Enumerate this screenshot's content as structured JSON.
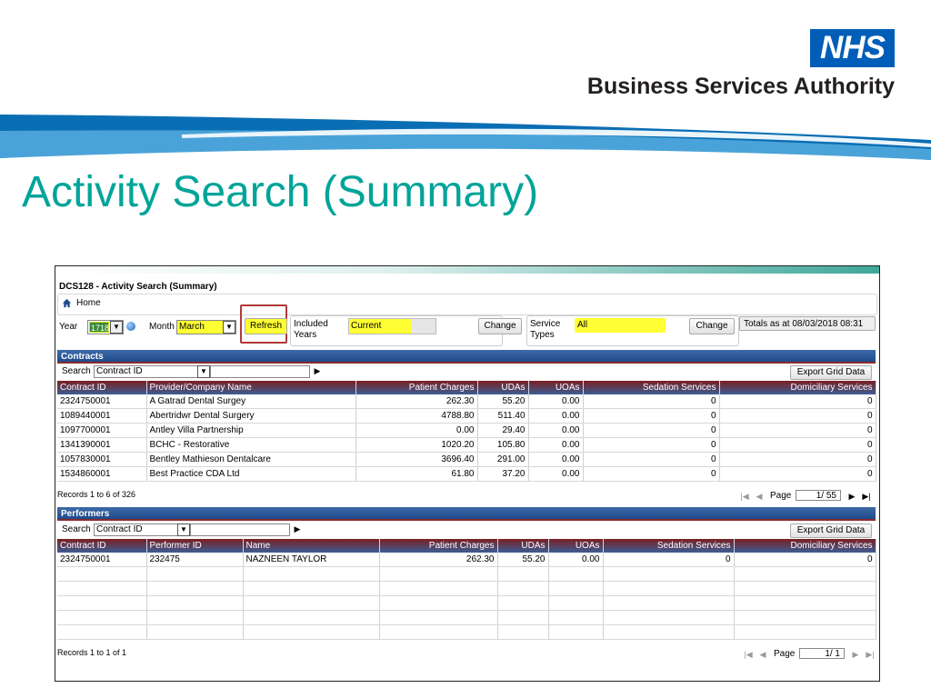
{
  "slide": {
    "logo_nhs": "NHS",
    "logo_org": "Business Services Authority",
    "title": "Activity Search (Summary)"
  },
  "colors": {
    "title": "#00a499",
    "nhs_blue": "#005eb8",
    "highlight": "#ffff33"
  },
  "app": {
    "title": "DCS128 - Activity Search (Summary)",
    "home": "Home",
    "filters": {
      "year_label": "Year",
      "year_value": "1718",
      "month_label": "Month",
      "month_value": "March",
      "refresh": "Refresh",
      "included_years_label_1": "Included",
      "included_years_label_2": "Years",
      "included_years_value": "Current",
      "change": "Change",
      "service_types_label_1": "Service",
      "service_types_label_2": "Types",
      "service_types_value": "All",
      "totals": "Totals as at 08/03/2018 08:31"
    },
    "contracts": {
      "heading": "Contracts",
      "search_label": "Search",
      "search_field": "Contract ID",
      "export": "Export Grid Data",
      "columns": [
        "Contract ID",
        "Provider/Company Name",
        "Patient Charges",
        "UDAs",
        "UOAs",
        "Sedation Services",
        "Domiciliary Services"
      ],
      "rows": [
        [
          "2324750001",
          "A Gatrad Dental Surgey",
          "262.30",
          "55.20",
          "0.00",
          "0",
          "0"
        ],
        [
          "1089440001",
          "Abertridwr Dental Surgery",
          "4788.80",
          "511.40",
          "0.00",
          "0",
          "0"
        ],
        [
          "1097700001",
          "Antley Villa Partnership",
          "0.00",
          "29.40",
          "0.00",
          "0",
          "0"
        ],
        [
          "1341390001",
          "BCHC - Restorative",
          "1020.20",
          "105.80",
          "0.00",
          "0",
          "0"
        ],
        [
          "1057830001",
          "Bentley Mathieson Dentalcare",
          "3696.40",
          "291.00",
          "0.00",
          "0",
          "0"
        ],
        [
          "1534860001",
          "Best Practice CDA Ltd",
          "61.80",
          "37.20",
          "0.00",
          "0",
          "0"
        ]
      ],
      "records": "Records 1 to 6 of 326",
      "page_label": "Page",
      "page_value": "1/ 55"
    },
    "performers": {
      "heading": "Performers",
      "search_label": "Search",
      "search_field": "Contract ID",
      "export": "Export Grid Data",
      "columns": [
        "Contract ID",
        "Performer ID",
        "Name",
        "Patient Charges",
        "UDAs",
        "UOAs",
        "Sedation Services",
        "Domiciliary Services"
      ],
      "rows": [
        [
          "2324750001",
          "232475",
          "NAZNEEN TAYLOR",
          "262.30",
          "55.20",
          "0.00",
          "0",
          "0"
        ]
      ],
      "empty_rows": 5,
      "records": "Records 1 to 1 of 1",
      "page_label": "Page",
      "page_value": "1/ 1"
    }
  }
}
